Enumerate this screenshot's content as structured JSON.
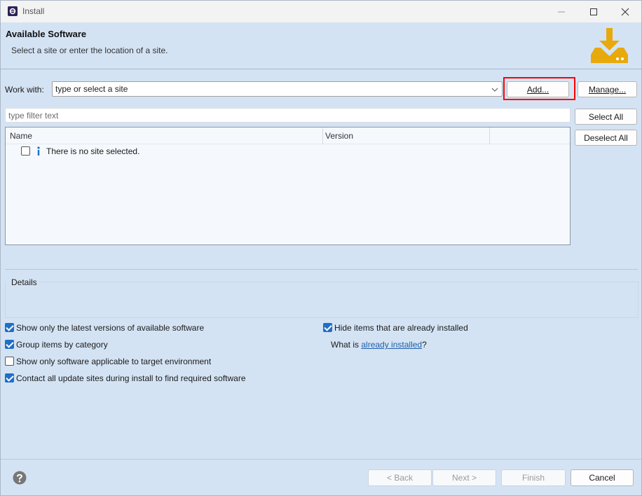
{
  "window": {
    "title": "Install",
    "app_icon": "eclipse-icon",
    "controls": [
      "minimize-icon",
      "maximize-icon",
      "close-icon"
    ]
  },
  "header": {
    "title": "Available Software",
    "subtitle": "Select a site or enter the location of a site.",
    "icon": "install-download-icon",
    "icon_color": "#e8a90c"
  },
  "work_with": {
    "label": "Work with:",
    "combo_value": "type or select a site",
    "add_button": "Add...",
    "manage_button": "Manage...",
    "highlight_color": "#ff0000"
  },
  "filter": {
    "placeholder": "type filter text"
  },
  "selection_buttons": {
    "select_all": "Select All",
    "deselect_all": "Deselect All"
  },
  "table": {
    "columns": [
      "Name",
      "Version"
    ],
    "rows": [
      {
        "checked": false,
        "icon": "info-icon",
        "name": "There is no site selected."
      }
    ]
  },
  "details": {
    "label": "Details"
  },
  "options": {
    "show_latest": {
      "checked": true,
      "label": "Show only the latest versions of available software"
    },
    "group_by_category": {
      "checked": true,
      "label": "Group items by category"
    },
    "applicable_only": {
      "checked": false,
      "label": "Show only software applicable to target environment"
    },
    "contact_all_sites": {
      "checked": true,
      "label": "Contact all update sites during install to find required software"
    },
    "hide_installed": {
      "checked": true,
      "label": "Hide items that are already installed"
    },
    "what_is_prefix": "What is",
    "what_is_link": "already installed",
    "what_is_suffix": "?"
  },
  "footer": {
    "back": "< Back",
    "next": "Next >",
    "finish": "Finish",
    "cancel": "Cancel",
    "help_icon": "help-icon"
  },
  "colors": {
    "accent": "#1f6fc6",
    "panel_background": "#d4e3f4",
    "link": "#1f5fa8"
  }
}
